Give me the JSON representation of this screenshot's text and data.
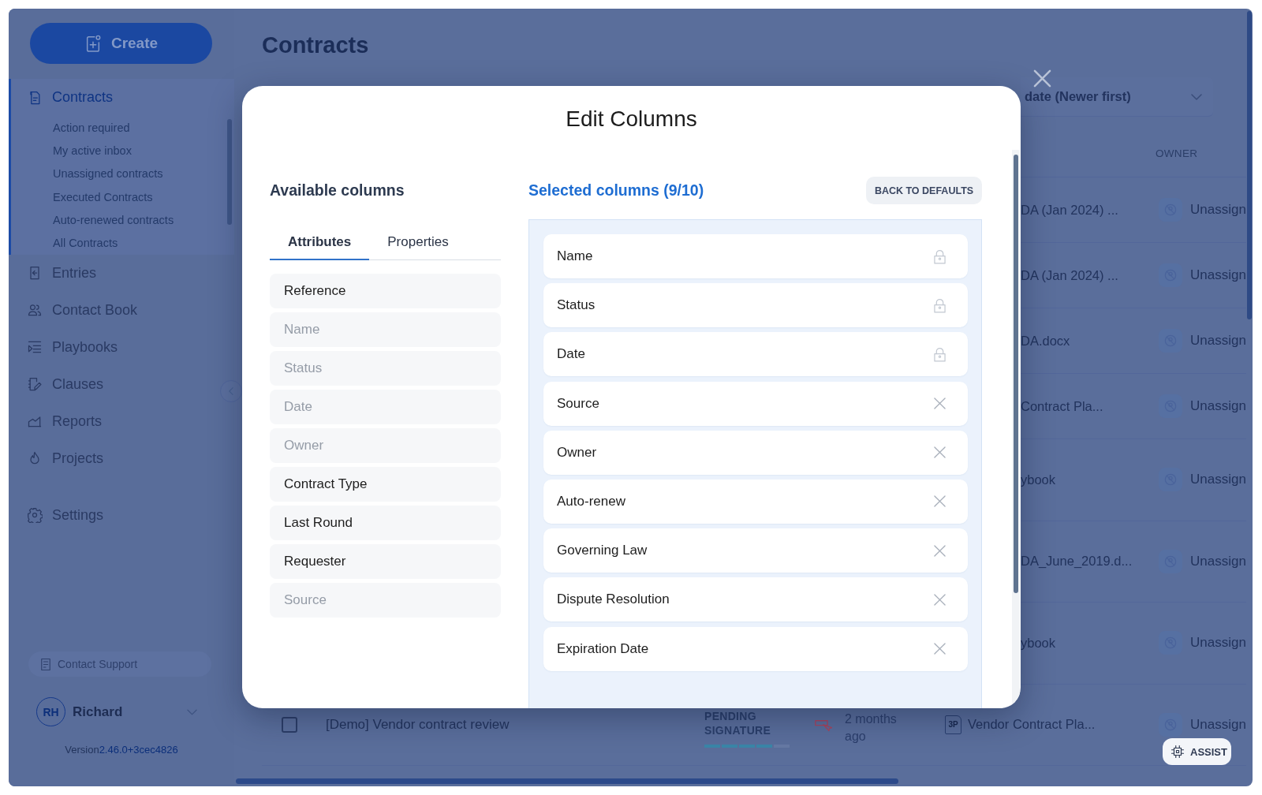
{
  "sidebar": {
    "create_button": "Create",
    "nav": [
      {
        "label": "Contracts",
        "selected": true,
        "children": [
          {
            "label": "Action required",
            "selected": false
          },
          {
            "label": "My active inbox",
            "selected": false
          },
          {
            "label": "Unassigned contracts",
            "selected": false
          },
          {
            "label": "Executed Contracts",
            "selected": false
          },
          {
            "label": "Auto-renewed contracts",
            "selected": false
          },
          {
            "label": "All Contracts",
            "selected": false
          }
        ]
      },
      {
        "label": "Entries",
        "selected": false
      },
      {
        "label": "Contact Book",
        "selected": false
      },
      {
        "label": "Playbooks",
        "selected": false
      },
      {
        "label": "Clauses",
        "selected": false
      },
      {
        "label": "Reports",
        "selected": false
      },
      {
        "label": "Projects",
        "selected": false
      }
    ],
    "nav_secondary": [
      {
        "label": "Settings",
        "selected": false
      }
    ],
    "contact_support": "Contact Support",
    "user": {
      "initials": "RH",
      "name": "Richard"
    },
    "version_label": "Version",
    "version_number": "2.46.0+3cec4826"
  },
  "page": {
    "title": "Contracts",
    "sort_dropdown": "date (Newer first)",
    "table": {
      "columns": [
        {
          "label": "OWNER"
        }
      ],
      "rows": [
        {
          "kind": "partial",
          "document": "DA (Jan 2024) ...",
          "owner": "Unassign"
        },
        {
          "kind": "partial",
          "document": "DA (Jan 2024) ...",
          "owner": "Unassign"
        },
        {
          "kind": "partial",
          "document": "DA.docx",
          "owner": "Unassign"
        },
        {
          "kind": "partial",
          "document": "Contract Pla...",
          "owner": "Unassign"
        },
        {
          "kind": "partial",
          "document": "ybook",
          "owner": "Unassign"
        },
        {
          "kind": "partial",
          "document": "DA_June_2019.d...",
          "owner": "Unassign"
        },
        {
          "kind": "partial",
          "document": "ybook",
          "owner": "Unassign"
        },
        {
          "kind": "full",
          "checked": false,
          "title": "[Demo] Vendor contract review",
          "status": "PENDING SIGNATURE",
          "level": 0.8,
          "age": "2 months ago",
          "file_badge": "3P",
          "document": "Vendor Contract Pla...",
          "owner": "Unassign"
        }
      ]
    }
  },
  "modal": {
    "title": "Edit Columns",
    "available": {
      "heading": "Available columns",
      "tabs": [
        {
          "label": "Attributes",
          "selected": true
        },
        {
          "label": "Properties",
          "selected": false
        }
      ],
      "items": [
        {
          "label": "Reference",
          "disabled": false
        },
        {
          "label": "Name",
          "disabled": true
        },
        {
          "label": "Status",
          "disabled": true
        },
        {
          "label": "Date",
          "disabled": true
        },
        {
          "label": "Owner",
          "disabled": true
        },
        {
          "label": "Contract Type",
          "disabled": false
        },
        {
          "label": "Last Round",
          "disabled": false
        },
        {
          "label": "Requester",
          "disabled": false
        },
        {
          "label": "Source",
          "disabled": true
        }
      ]
    },
    "selected": {
      "heading": "Selected columns (9/10)",
      "reset_button": "BACK TO DEFAULTS",
      "items": [
        {
          "label": "Name",
          "locked": true
        },
        {
          "label": "Status",
          "locked": true
        },
        {
          "label": "Date",
          "locked": true
        },
        {
          "label": "Source",
          "locked": false
        },
        {
          "label": "Owner",
          "locked": false
        },
        {
          "label": "Auto-renew",
          "locked": false
        },
        {
          "label": "Governing Law",
          "locked": false
        },
        {
          "label": "Dispute Resolution",
          "locked": false
        },
        {
          "label": "Expiration Date",
          "locked": false
        }
      ]
    }
  },
  "assist_button": "ASSIST"
}
